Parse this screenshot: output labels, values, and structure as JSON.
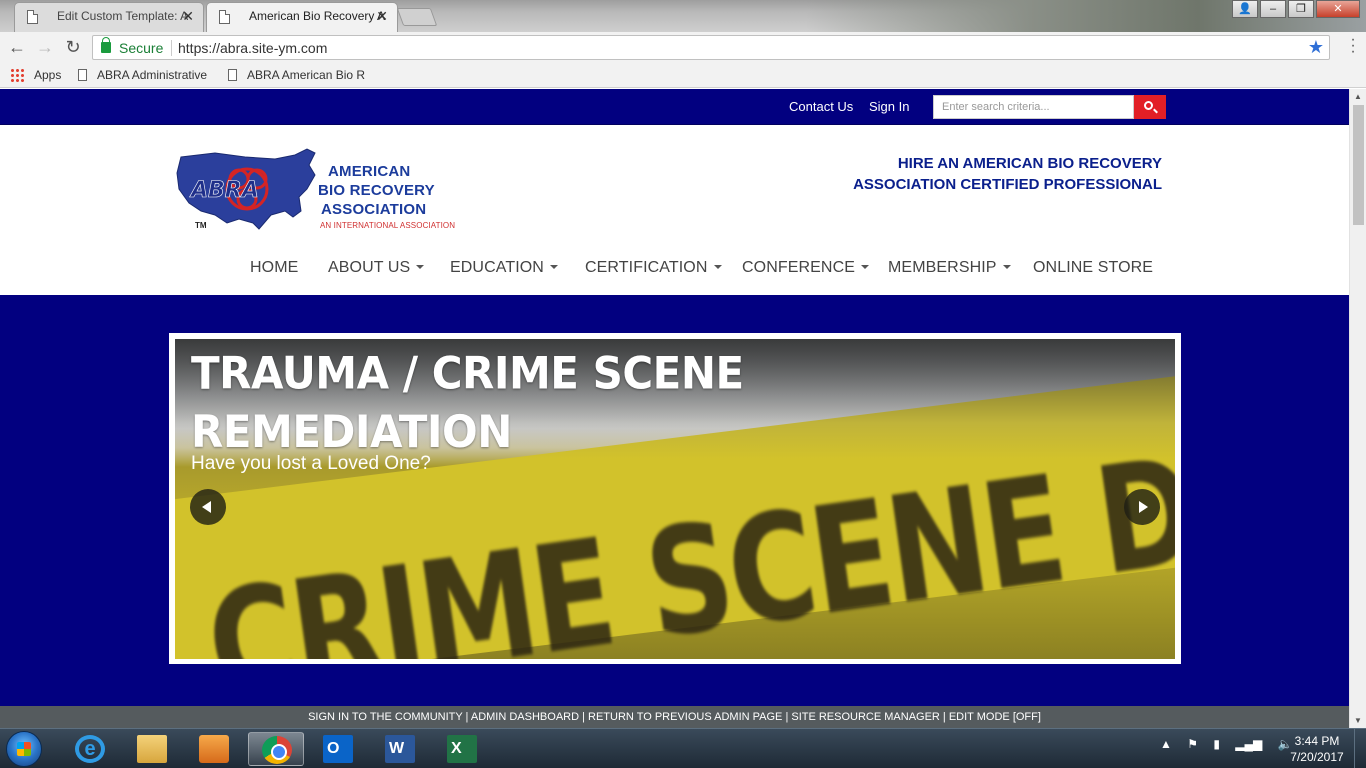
{
  "browser": {
    "tabs": [
      {
        "title": "Edit Custom Template: A"
      },
      {
        "title": "American Bio Recovery A"
      }
    ],
    "security_label": "Secure",
    "url": "https://abra.site-ym.com",
    "bookmarks": [
      {
        "label": "Apps"
      },
      {
        "label": "ABRA Administrative"
      },
      {
        "label": "ABRA American Bio R"
      }
    ]
  },
  "site": {
    "topbar": {
      "contact_label": "Contact Us",
      "signin_label": "Sign In",
      "search_placeholder": "Enter search criteria..."
    },
    "logo": {
      "line1": "AMERICAN",
      "line2": "BIO RECOVERY",
      "line3": "ASSOCIATION",
      "line4": "AN INTERNATIONAL ASSOCIATION",
      "emblem": "ABRA",
      "tm": "TM"
    },
    "tagline": {
      "line1": "HIRE AN AMERICAN BIO RECOVERY",
      "line2": "ASSOCIATION CERTIFIED PROFESSIONAL"
    },
    "nav": [
      {
        "label": "HOME"
      },
      {
        "label": "ABOUT US"
      },
      {
        "label": "EDUCATION"
      },
      {
        "label": "CERTIFICATION"
      },
      {
        "label": "CONFERENCE"
      },
      {
        "label": "MEMBERSHIP"
      },
      {
        "label": "ONLINE STORE"
      }
    ],
    "slider": {
      "title_line1": "TRAUMA / CRIME SCENE",
      "title_line2": "REMEDIATION",
      "subtitle": "Have you lost a Loved One?",
      "tape_text": "CRIME SCENE DO NOT CROSS"
    },
    "adminbar": "SIGN IN TO THE COMMUNITY | ADMIN DASHBOARD | RETURN TO PREVIOUS ADMIN PAGE | SITE RESOURCE MANAGER | EDIT MODE [OFF]"
  },
  "taskbar": {
    "time": "3:44 PM",
    "date": "7/20/2017"
  },
  "colors": {
    "site_navy": "#020080",
    "search_red": "#e21f26",
    "tagline_blue": "#0a1f8c"
  }
}
